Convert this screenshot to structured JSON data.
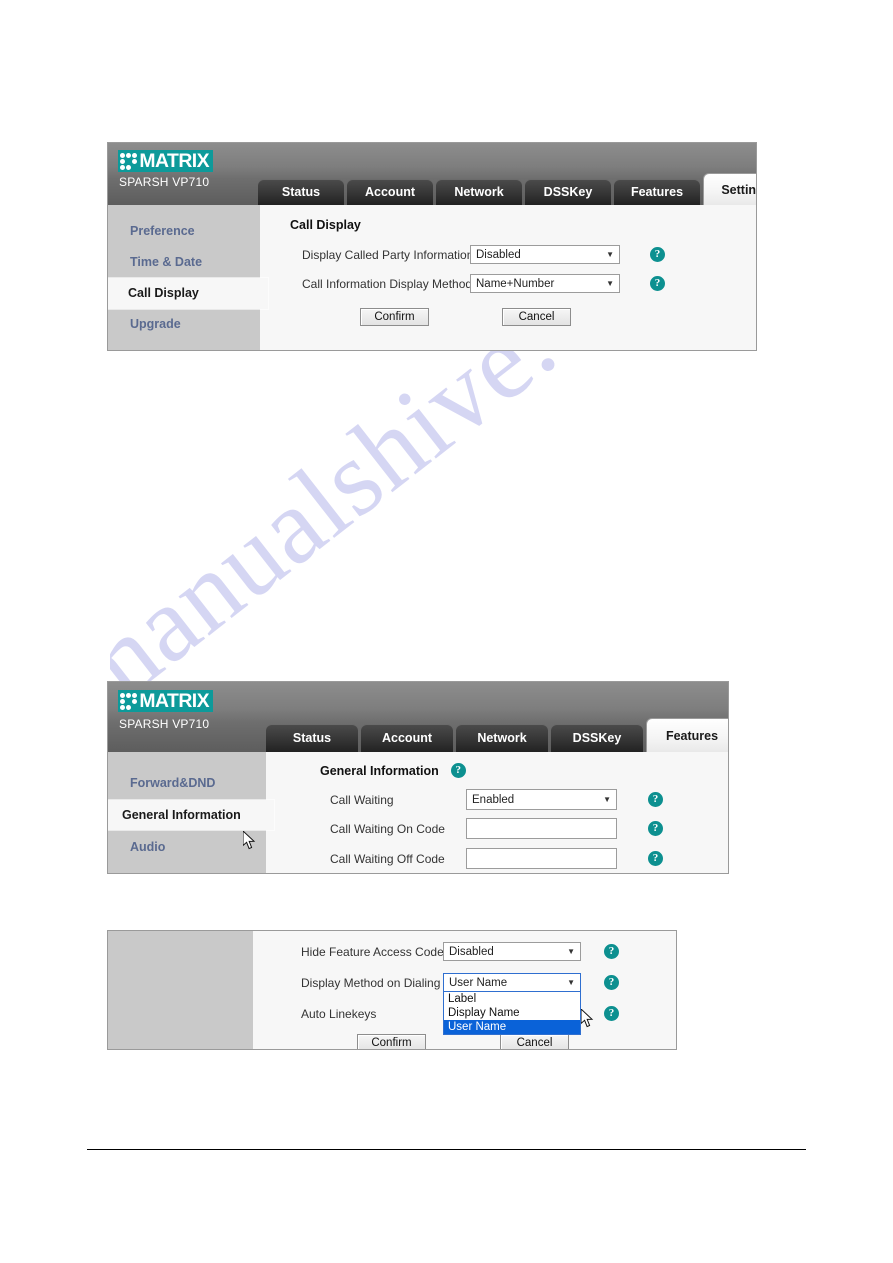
{
  "document": {
    "watermark": "manualshive.com",
    "footer_rule": true
  },
  "brand": {
    "logo_word": "MATRIX",
    "model": "SPARSH VP710",
    "logo_color": "#0d9a9a",
    "help_icon_color": "#0d9090",
    "highlight_color": "#0a62d8",
    "help_glyph": "?",
    "dropdown_arrow": "▼"
  },
  "panels": [
    {
      "id": "settings-call-display",
      "tabs": [
        {
          "label": "Status",
          "active": false
        },
        {
          "label": "Account",
          "active": false
        },
        {
          "label": "Network",
          "active": false
        },
        {
          "label": "DSSKey",
          "active": false
        },
        {
          "label": "Features",
          "active": false
        },
        {
          "label": "Settings",
          "active": true
        }
      ],
      "sidebar": [
        {
          "label": "Preference",
          "active": false
        },
        {
          "label": "Time & Date",
          "active": false
        },
        {
          "label": "Call Display",
          "active": true
        },
        {
          "label": "Upgrade",
          "active": false
        }
      ],
      "section_title": "Call Display",
      "rows": [
        {
          "label": "Display Called Party Information",
          "type": "select",
          "value": "Disabled"
        },
        {
          "label": "Call Information Display Method",
          "type": "select",
          "value": "Name+Number"
        }
      ],
      "buttons": {
        "confirm": "Confirm",
        "cancel": "Cancel"
      }
    },
    {
      "id": "features-general-information",
      "tabs": [
        {
          "label": "Status",
          "active": false
        },
        {
          "label": "Account",
          "active": false
        },
        {
          "label": "Network",
          "active": false
        },
        {
          "label": "DSSKey",
          "active": false
        },
        {
          "label": "Features",
          "active": true
        }
      ],
      "sidebar": [
        {
          "label": "Forward&DND",
          "active": false
        },
        {
          "label": "General Information",
          "active": true
        },
        {
          "label": "Audio",
          "active": false
        }
      ],
      "section_title": "General Information",
      "rows": [
        {
          "label": "Call Waiting",
          "type": "select",
          "value": "Enabled"
        },
        {
          "label": "Call Waiting On Code",
          "type": "text",
          "value": ""
        },
        {
          "label": "Call Waiting Off Code",
          "type": "text",
          "value": ""
        }
      ]
    },
    {
      "id": "features-display-method",
      "rows": [
        {
          "label": "Hide Feature Access Codes",
          "type": "select",
          "value": "Disabled"
        },
        {
          "label": "Display Method on Dialing",
          "type": "select-open",
          "value": "User Name",
          "options": [
            "Label",
            "Display Name",
            "User Name"
          ],
          "selected_option": "User Name"
        },
        {
          "label": "Auto Linekeys",
          "type": "none",
          "value": ""
        }
      ],
      "buttons": {
        "confirm": "Confirm",
        "cancel": "Cancel"
      }
    }
  ]
}
